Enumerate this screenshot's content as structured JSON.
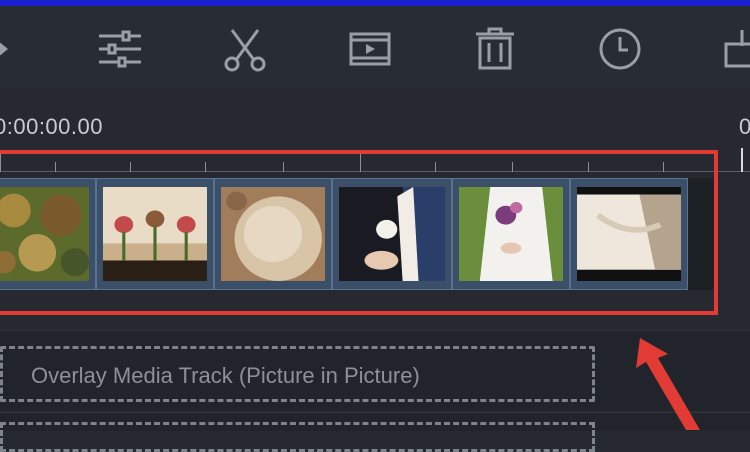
{
  "toolbar": {
    "tools": [
      {
        "icon": "play-icon"
      },
      {
        "icon": "adjust-sliders-icon"
      },
      {
        "icon": "scissors-icon"
      },
      {
        "icon": "video-clip-icon"
      },
      {
        "icon": "trash-icon"
      },
      {
        "icon": "clock-icon"
      },
      {
        "icon": "export-icon"
      }
    ]
  },
  "timeline": {
    "start_time": "0:00:00.00",
    "end_time_partial": "0"
  },
  "video_track": {
    "clips": [
      {
        "name": "floral-wreath-clip",
        "colors": [
          "#5a6b2a",
          "#a9883e",
          "#7a5a2c"
        ]
      },
      {
        "name": "boutonnieres-clip",
        "colors": [
          "#e7d9c3",
          "#8a6a3c",
          "#3a2b1c"
        ]
      },
      {
        "name": "lace-fabric-clip",
        "colors": [
          "#cbb292",
          "#9f7d5c",
          "#e2d3be"
        ]
      },
      {
        "name": "groom-boutonniere-clip",
        "colors": [
          "#1b1c24",
          "#2a3e6a",
          "#f2eee8"
        ]
      },
      {
        "name": "bride-bouquet-clip",
        "colors": [
          "#f4f2f0",
          "#7b3c7e",
          "#6c8f3c"
        ]
      },
      {
        "name": "wedding-dress-clip",
        "colors": [
          "#efe8de",
          "#d4c6b2",
          "#7c6c5c"
        ]
      }
    ]
  },
  "overlay_track": {
    "label": "Overlay Media Track (Picture in Picture)"
  },
  "colors": {
    "highlight": "#e23b35",
    "clip_frame": "#3b4f69"
  }
}
